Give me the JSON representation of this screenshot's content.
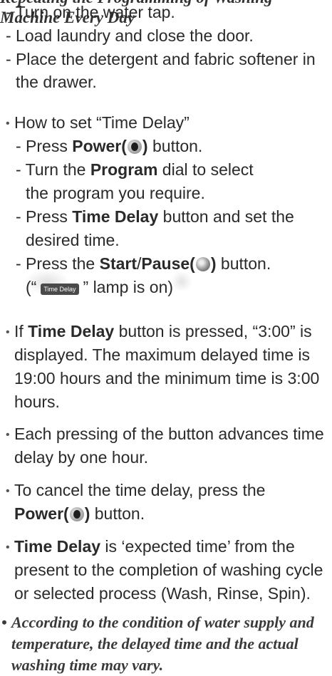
{
  "cut_line": "Repeating the Programming of Washing Machine Every Day",
  "prep": [
    "- Turn on the water tap.",
    "- Load laundry and close the door.",
    "- Place the detergent and fabric softener in",
    "the drawer."
  ],
  "how_to": {
    "heading": "How to set “Time Delay”",
    "step1": {
      "pre": "- Press ",
      "bold": "Power(",
      "bold_close": ")",
      "post": " button."
    },
    "step2": {
      "pre": "- Turn the ",
      "bold": "Program",
      "post": " dial to select",
      "line2": "the program you require."
    },
    "step3": {
      "pre": "- Press ",
      "bold": "Time Delay",
      "post": " button and set the",
      "line2": "desired time."
    },
    "step4": {
      "pre": "- Press the ",
      "bold1": "Start",
      "slash": "/",
      "bold2": "Pause(",
      "bold_close": ")",
      "post": " button."
    },
    "lamp": {
      "open": "(“",
      "label": "Time Delay",
      "close": "” lamp is on)"
    }
  },
  "bullets": {
    "b1": {
      "pre": "If ",
      "bold": "Time Delay",
      "post": " button is pressed, “3:00” is",
      "l2": "displayed. The maximum delayed time is",
      "l3": "19:00 hours and the minimum time is 3:00",
      "l4": "hours."
    },
    "b2": {
      "l1": "Each pressing of the button advances time",
      "l2": "delay by one hour."
    },
    "b3": {
      "l1": "To cancel the time delay, press the",
      "bold": "Power(",
      "bold_close": ")",
      "post": " button."
    },
    "b4": {
      "bold": "Time Delay",
      "post": " is ‘expected time’ from the",
      "l2": "present to the completion of washing cycle",
      "l3": "or selected process (Wash, Rinse, Spin)."
    }
  },
  "note": {
    "l1": "According to the condition of water supply and",
    "l2": "temperature, the delayed time and the actual",
    "l3": "washing time may vary."
  },
  "bullet_glyph": "•"
}
